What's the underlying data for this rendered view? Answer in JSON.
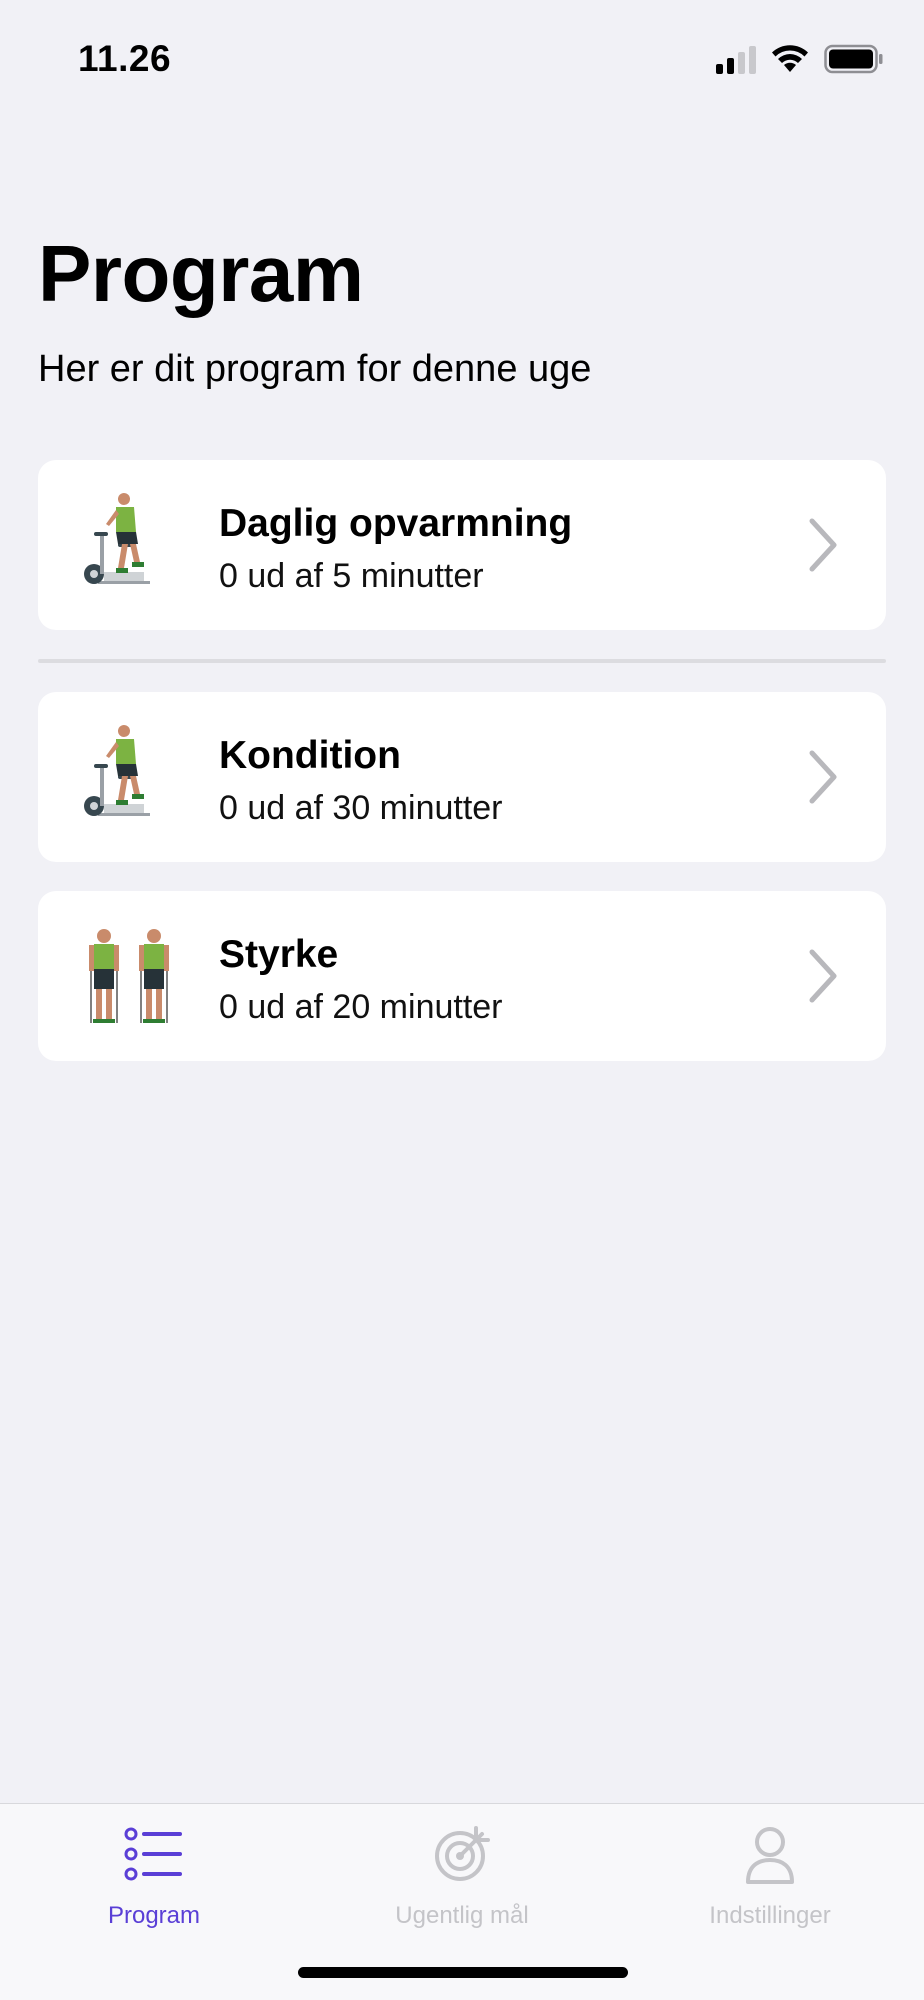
{
  "status_bar": {
    "time": "11.26"
  },
  "header": {
    "title": "Program",
    "subtitle": "Her er dit program for denne uge"
  },
  "program_items": [
    {
      "title": "Daglig opvarmning",
      "progress": "0 ud af 5 minutter",
      "icon": "exercise-bike-figure-icon"
    },
    {
      "title": "Kondition",
      "progress": "0 ud af 30 minutter",
      "icon": "exercise-bike-figure-icon"
    },
    {
      "title": "Styrke",
      "progress": "0 ud af 20 minutter",
      "icon": "resistance-band-figures-icon"
    }
  ],
  "tab_bar": {
    "tabs": [
      {
        "label": "Program",
        "icon": "list-icon",
        "active": true
      },
      {
        "label": "Ugentlig mål",
        "icon": "target-icon",
        "active": false
      },
      {
        "label": "Indstillinger",
        "icon": "person-icon",
        "active": false
      }
    ]
  },
  "colors": {
    "accent": "#5a3fd6",
    "background": "#f1f1f6",
    "card": "#ffffff",
    "inactive_tab": "#c4c4c8",
    "figure_shirt": "#7cb342"
  }
}
